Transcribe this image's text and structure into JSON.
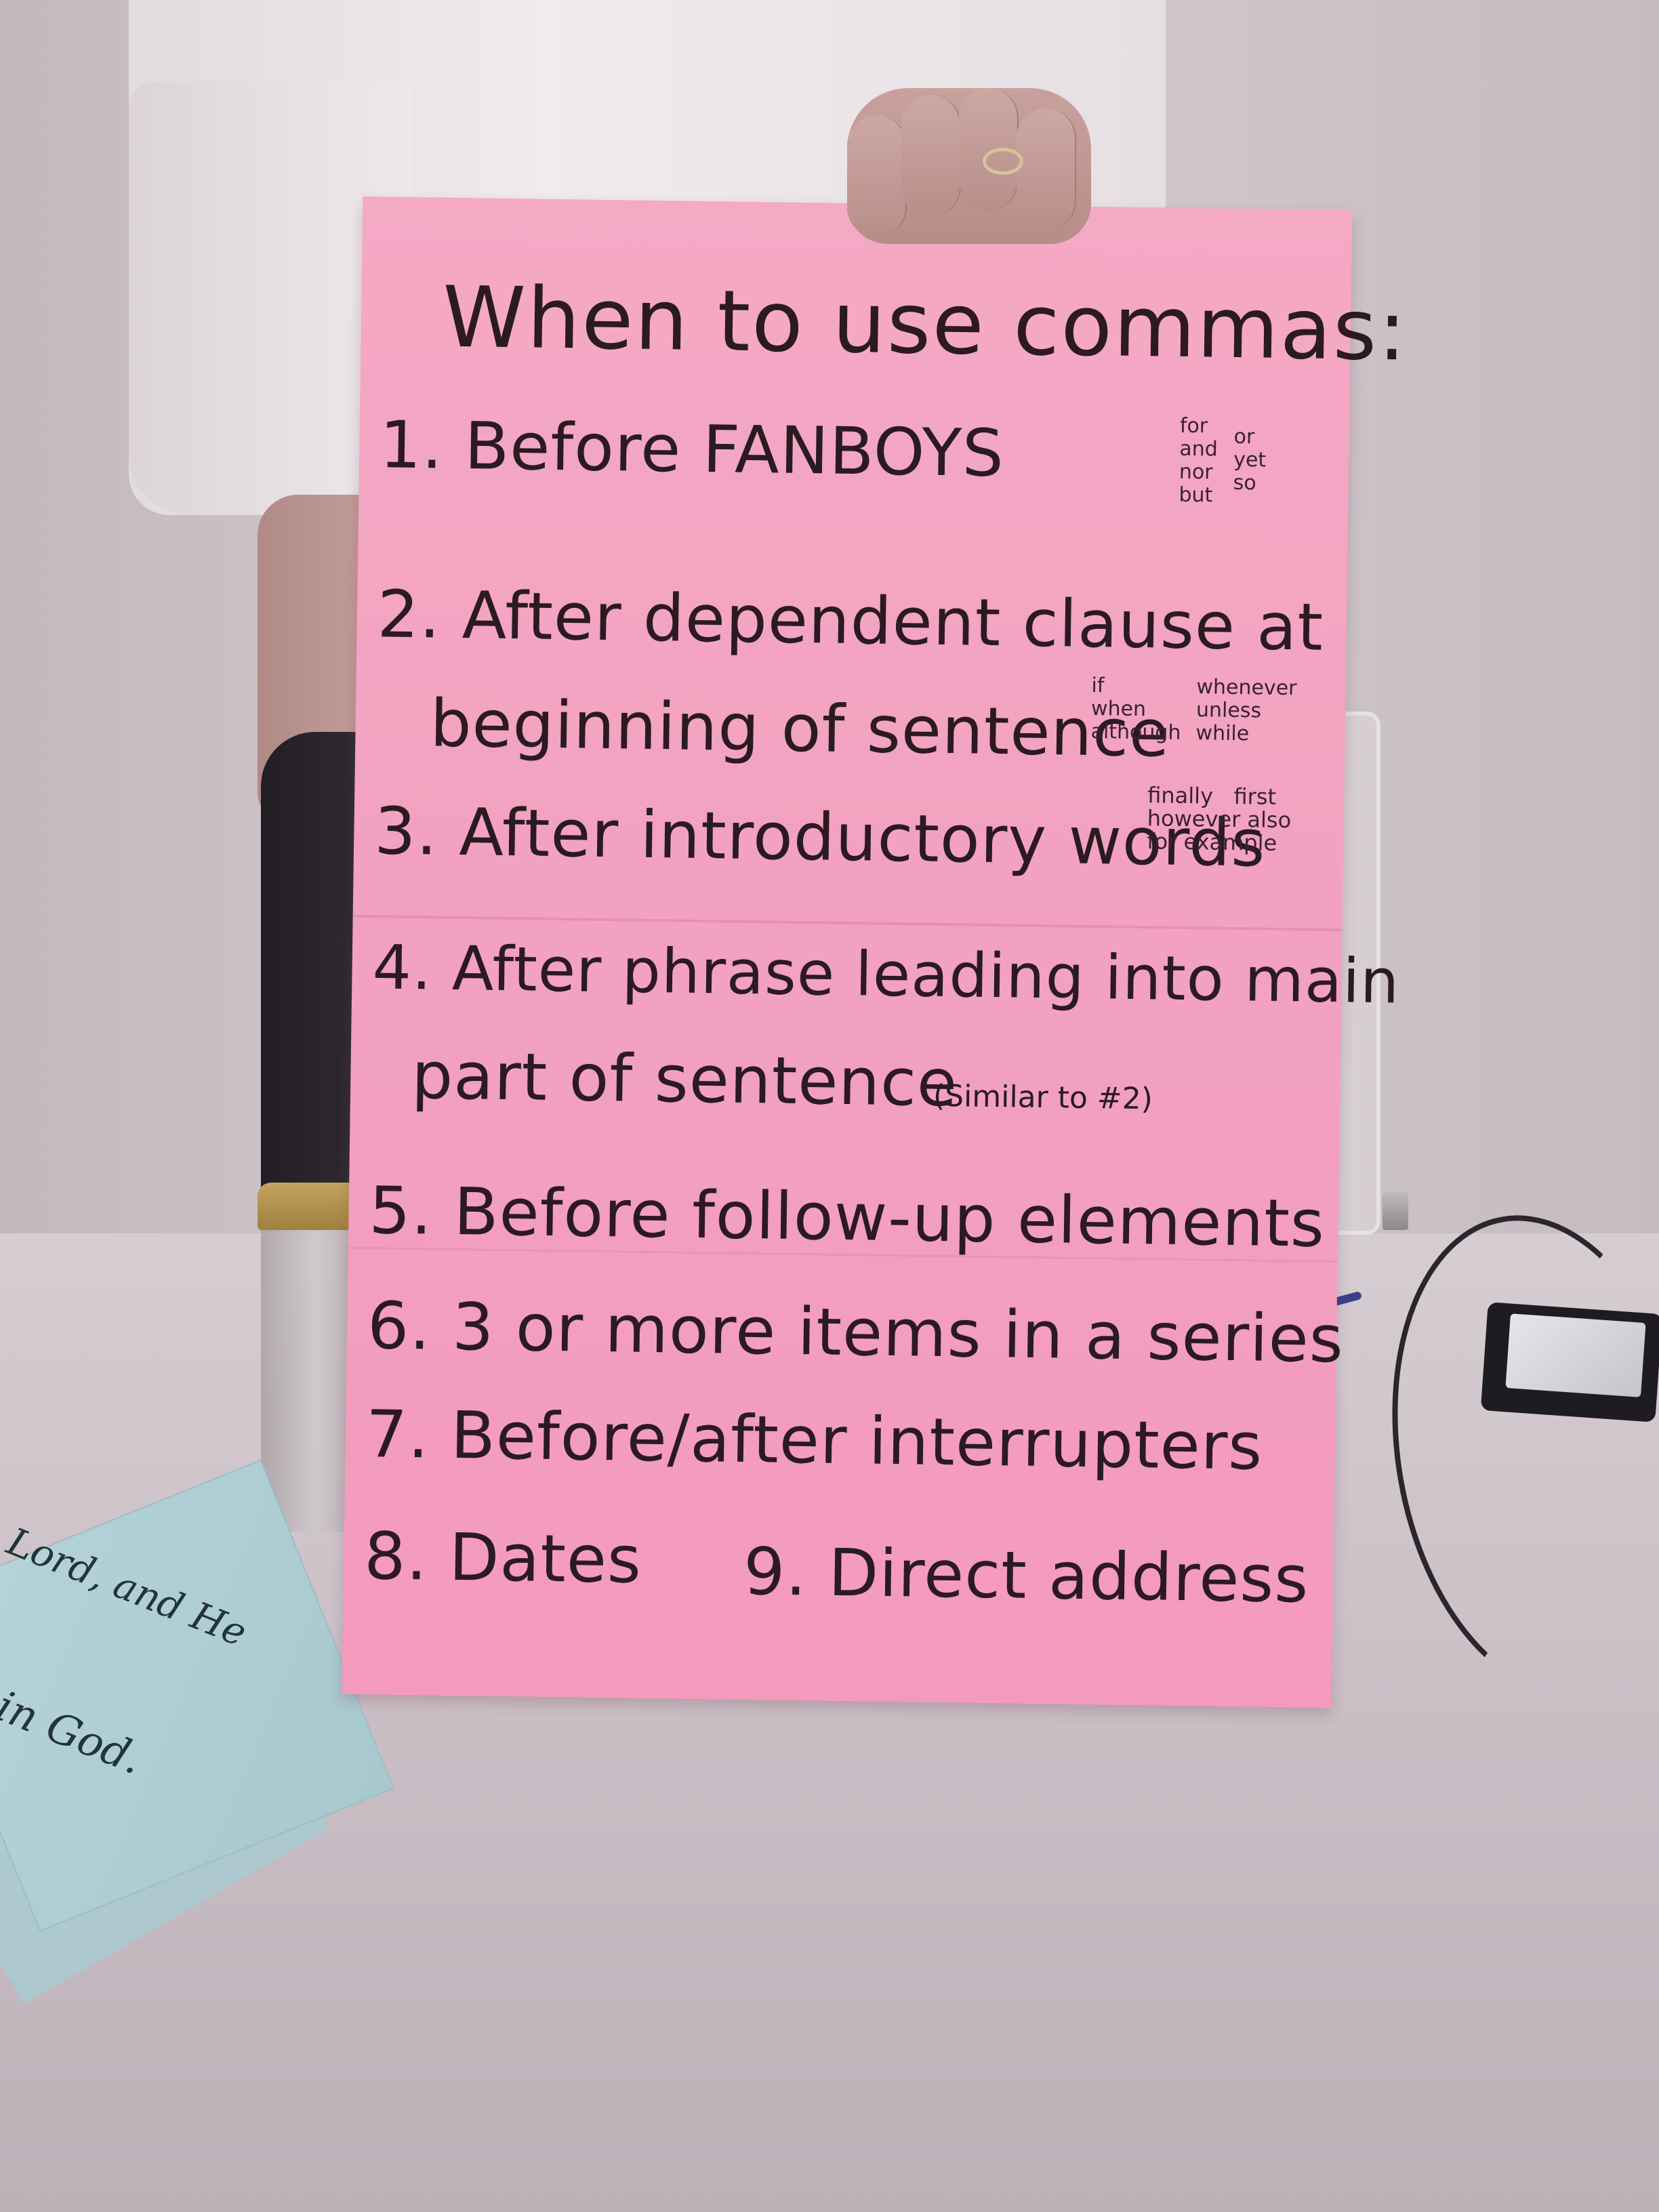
{
  "poster": {
    "title": "When to use commas:",
    "rules": [
      "1. Before FANBOYS",
      "2. After dependent clause at",
      "beginning of sentence",
      "3. After introductory words",
      "4. After phrase leading into main",
      "part of sentence",
      "5. Before follow-up elements",
      "6. 3 or more items in a series",
      "7. Before/after interrupters",
      "8. Dates",
      "9. Direct address"
    ],
    "fanboys_col1": "for\nand\nnor\nbut",
    "fanboys_col2": "or\nyet\nso",
    "clause_col1": "if\nwhen\nalthough",
    "clause_col2": "whenever\nunless\nwhile",
    "intro_words": "finally   first\nhowever also\nfor example",
    "rule4_note": "(Similar to #2)"
  },
  "blue_card": {
    "line1": "Lord, and He",
    "line2": "in God."
  },
  "colors": {
    "poster": "#f2a2c0",
    "ink": "#2b1a22",
    "blue_card": "#a7c8cf"
  }
}
